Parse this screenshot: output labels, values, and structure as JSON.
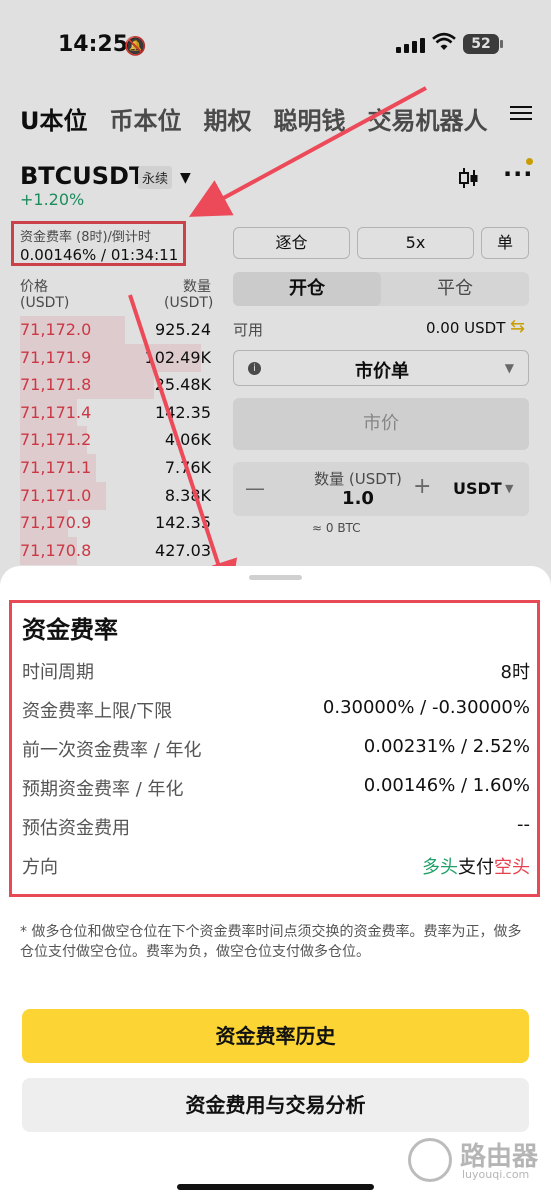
{
  "status_bar": {
    "time": "14:25",
    "battery": "52"
  },
  "top_nav": {
    "items": [
      "U本位",
      "币本位",
      "期权",
      "聪明钱",
      "交易机器人"
    ],
    "active": 0
  },
  "pair": {
    "symbol": "BTCUSDT",
    "type": "永续",
    "change": "+1.20%"
  },
  "funding_header": {
    "label": "资金费率 (8时)/倒计时",
    "value": "0.00146% / 01:34:11"
  },
  "order_book": {
    "price_header": "价格",
    "price_unit": "(USDT)",
    "qty_header": "数量",
    "qty_unit": "(USDT)",
    "rows": [
      {
        "price": "71,172.0",
        "qty": "925.24",
        "depth": 0.55
      },
      {
        "price": "71,171.9",
        "qty": "102.49K",
        "depth": 0.95
      },
      {
        "price": "71,171.8",
        "qty": "25.48K",
        "depth": 0.7
      },
      {
        "price": "71,171.4",
        "qty": "142.35",
        "depth": 0.3
      },
      {
        "price": "71,171.2",
        "qty": "4.06K",
        "depth": 0.35
      },
      {
        "price": "71,171.1",
        "qty": "7.76K",
        "depth": 0.4
      },
      {
        "price": "71,171.0",
        "qty": "8.38K",
        "depth": 0.45
      },
      {
        "price": "71,170.9",
        "qty": "142.35",
        "depth": 0.25
      },
      {
        "price": "71,170.8",
        "qty": "427.03",
        "depth": 0.3
      }
    ]
  },
  "order_form": {
    "margin_mode": "逐仓",
    "leverage": "5x",
    "position_mode": "单",
    "open_tab": "开仓",
    "close_tab": "平仓",
    "available_label": "可用",
    "available_value": "0.00 USDT",
    "order_type": "市价单",
    "market_label": "市价",
    "qty_label": "数量 (USDT)",
    "qty_value": "1.0",
    "qty_unit": "USDT",
    "btc_approx": "≈ 0 BTC"
  },
  "sheet": {
    "title": "资金费率",
    "rows": [
      {
        "label": "时间周期",
        "value": "8时"
      },
      {
        "label": "资金费率上限/下限",
        "value": "0.30000% / -0.30000%"
      },
      {
        "label": "前一次资金费率 / 年化",
        "value": "0.00231% / 2.52%"
      },
      {
        "label": "预期资金费率 / 年化",
        "value": "0.00146% / 1.60%"
      },
      {
        "label": "预估资金费用",
        "value": "--"
      }
    ],
    "direction": {
      "label": "方向",
      "long": "多头",
      "pay": "支付",
      "short": "空头"
    },
    "note": "* 做多仓位和做空仓位在下个资金费率时间点须交换的资金费率。费率为正，做多仓位支付做空仓位。费率为负，做空仓位支付做多仓位。",
    "primary_button": "资金费率历史",
    "secondary_button": "资金费用与交易分析"
  },
  "watermark": {
    "title": "路由器",
    "url": "luyouqi.com"
  },
  "colors": {
    "accent_yellow": "#fcd535",
    "up_green": "#21a06a",
    "down_red": "#e8404f",
    "highlight_red": "#e84a55"
  }
}
